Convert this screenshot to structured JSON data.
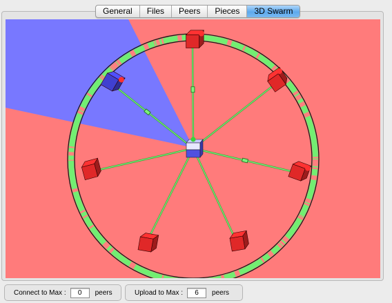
{
  "tabs": [
    {
      "label": "General",
      "active": false
    },
    {
      "label": "Files",
      "active": false
    },
    {
      "label": "Peers",
      "active": false
    },
    {
      "label": "Pieces",
      "active": false
    },
    {
      "label": "3D Swarm",
      "active": true
    }
  ],
  "swarm": {
    "background_colors": {
      "downloading_sector": "#ff7b7b",
      "uploading_sector": "#7878ff"
    },
    "ring_colors": {
      "have": "#72ee72",
      "missing": "#ff8080"
    },
    "local_peer": {
      "color": "#5050e0"
    },
    "remote_peers": [
      {
        "color": "#e02828",
        "transfer": "download"
      },
      {
        "color": "#e02828",
        "transfer": "download"
      },
      {
        "color": "#e02828",
        "transfer": "download"
      },
      {
        "color": "#e02828",
        "transfer": "download"
      },
      {
        "color": "#e02828",
        "transfer": "download"
      },
      {
        "color": "#e02828",
        "transfer": "download"
      },
      {
        "color": "#4040d0",
        "transfer": "upload"
      }
    ]
  },
  "status_bar": {
    "connect": {
      "label": "Connect to Max :",
      "value": "0",
      "unit": "peers"
    },
    "upload": {
      "label": "Upload to Max :",
      "value": "6",
      "unit": "peers"
    }
  }
}
